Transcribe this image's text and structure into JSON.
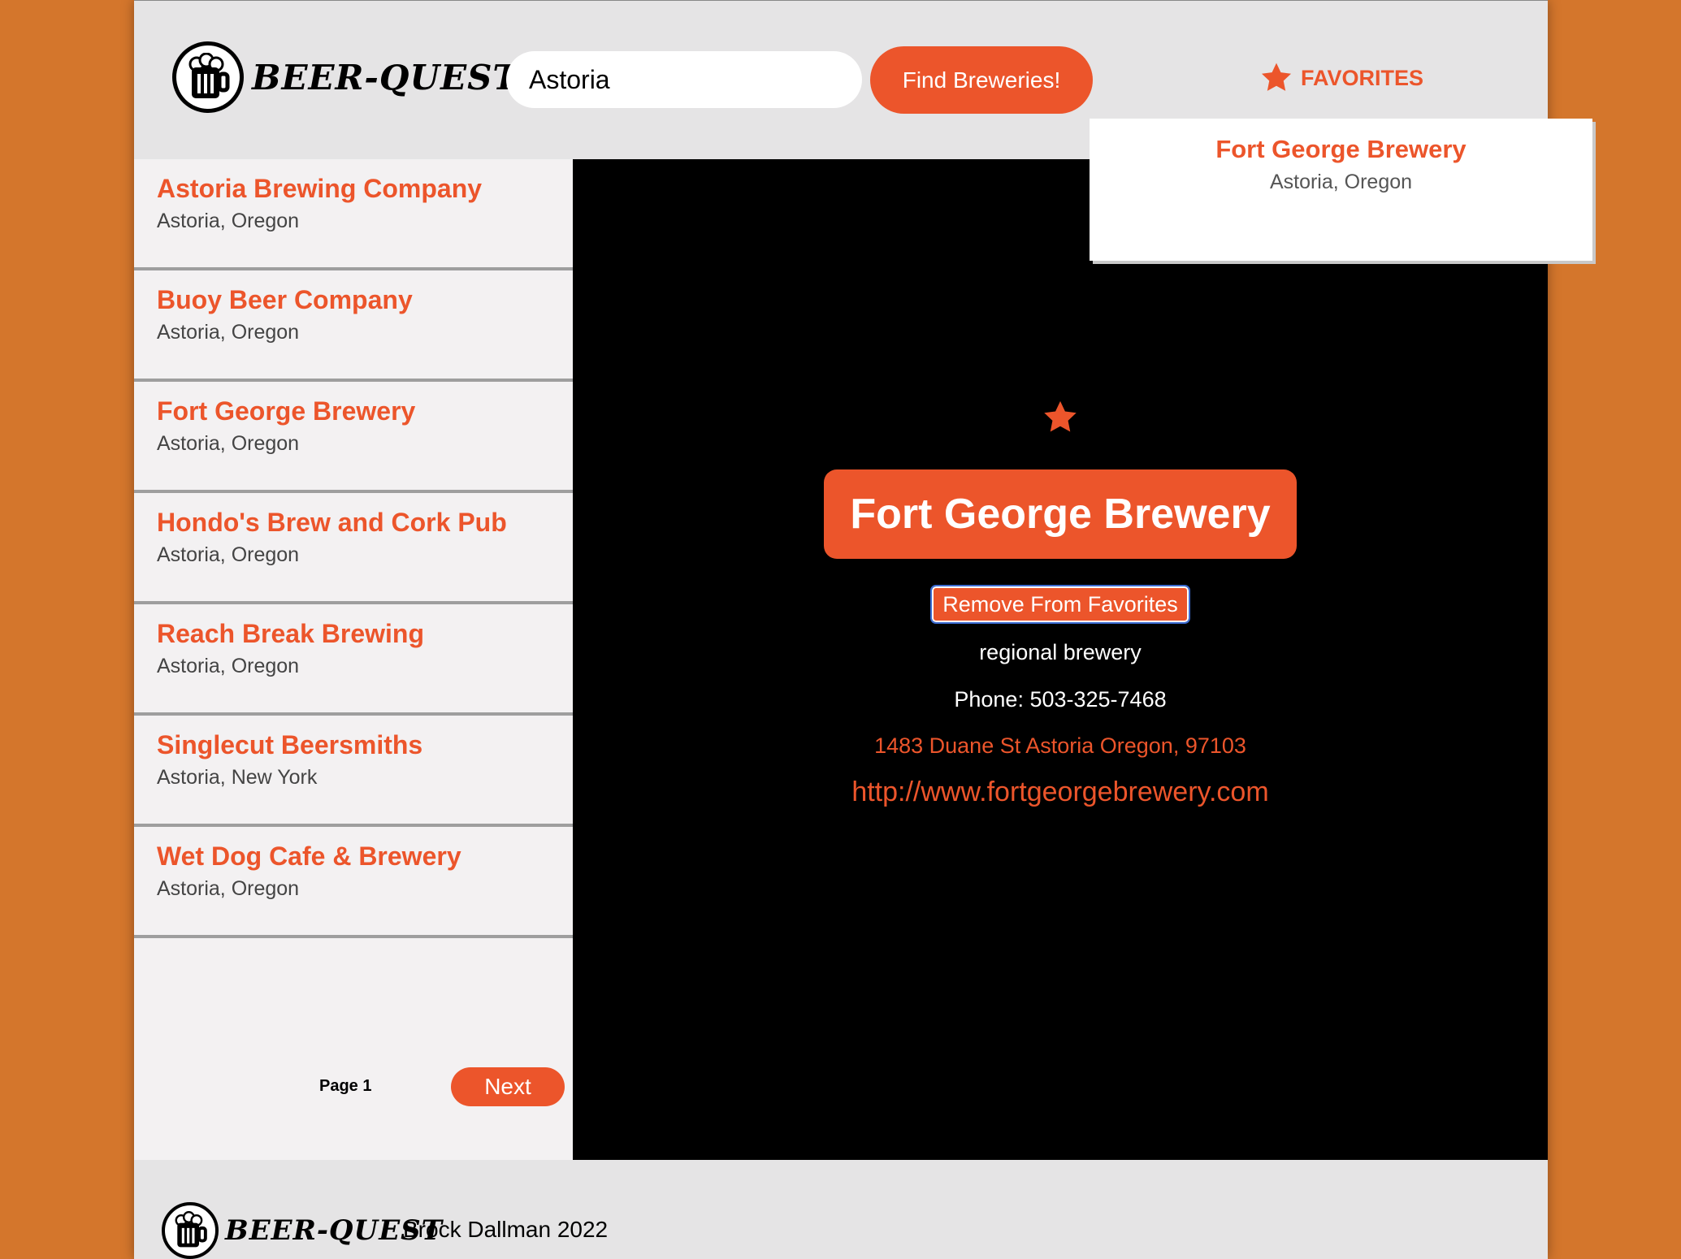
{
  "header": {
    "logo_text": "BEER-QUEST",
    "search_value": "Astoria",
    "find_button": "Find Breweries!",
    "favorites_label": "FAVORITES"
  },
  "favorites_dropdown": {
    "items": [
      {
        "name": "Fort George Brewery",
        "location": "Astoria, Oregon"
      }
    ]
  },
  "sidebar": {
    "items": [
      {
        "name": "Astoria Brewing Company",
        "location": "Astoria, Oregon"
      },
      {
        "name": "Buoy Beer Company",
        "location": "Astoria, Oregon"
      },
      {
        "name": "Fort George Brewery",
        "location": "Astoria, Oregon"
      },
      {
        "name": "Hondo's Brew and Cork Pub",
        "location": "Astoria, Oregon"
      },
      {
        "name": "Reach Break Brewing",
        "location": "Astoria, Oregon"
      },
      {
        "name": "Singlecut Beersmiths",
        "location": "Astoria, New York"
      },
      {
        "name": "Wet Dog Cafe & Brewery",
        "location": "Astoria, Oregon"
      }
    ],
    "page_label": "Page 1",
    "next_button": "Next"
  },
  "detail": {
    "name": "Fort George Brewery",
    "remove_button": "Remove From Favorites",
    "type": "regional brewery",
    "phone": "Phone: 503-325-7468",
    "address": "1483 Duane St Astoria Oregon, 97103",
    "url": "http://www.fortgeorgebrewery.com"
  },
  "footer": {
    "logo_text": "BEER-QUEST",
    "credit": "Brock Dallman 2022"
  },
  "colors": {
    "accent": "#ec552b",
    "background": "#d4762c",
    "panel": "#000000"
  }
}
